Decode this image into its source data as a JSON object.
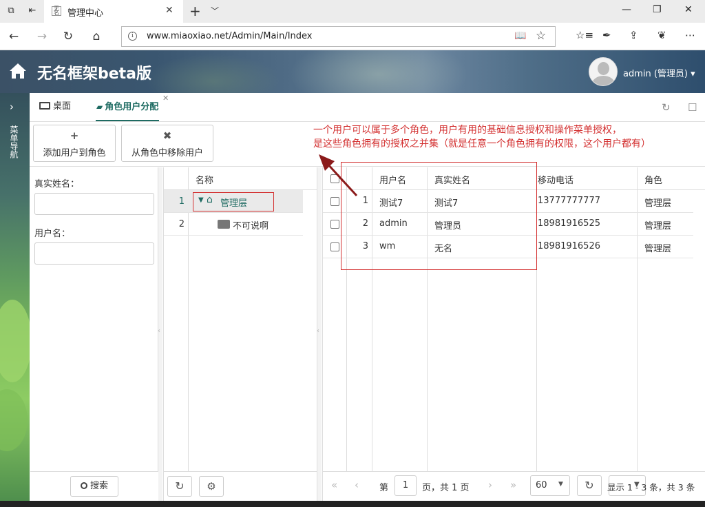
{
  "browser": {
    "tab_title": "管理中心",
    "url": "www.miaoxiao.net/Admin/Main/Index"
  },
  "header": {
    "title": "无名框架beta版",
    "user": "admin (管理员) ▾"
  },
  "sidebar": {
    "vertical_label": "菜单导航"
  },
  "tabs": [
    {
      "label": "桌面"
    },
    {
      "label": "角色用户分配"
    }
  ],
  "toolbar": {
    "add_label": "添加用户到角色",
    "remove_label": "从角色中移除用户"
  },
  "annotation": {
    "line1": "一个用户可以属于多个角色，用户有用的基础信息授权和操作菜单授权，",
    "line2": "是这些角色拥有的授权之并集（就是任意一个角色拥有的权限，这个用户都有）"
  },
  "filters": {
    "real_name_label": "真实姓名：",
    "username_label": "用户名：",
    "search_label": "搜索"
  },
  "tree": {
    "header": "名称",
    "rows": [
      {
        "num": "1",
        "label": "管理层"
      },
      {
        "num": "2",
        "label": "不可说啊"
      }
    ]
  },
  "grid": {
    "columns": [
      "用户名",
      "真实姓名",
      "移动电话",
      "角色"
    ],
    "rows": [
      {
        "num": "1",
        "username": "测试7",
        "realname": "测试7",
        "phone": "13777777777",
        "role": "管理层"
      },
      {
        "num": "2",
        "username": "admin",
        "realname": "管理员",
        "phone": "18981916525",
        "role": "管理层"
      },
      {
        "num": "3",
        "username": "wm",
        "realname": "无名",
        "phone": "18981916526",
        "role": "管理层"
      }
    ]
  },
  "pager": {
    "page_prefix": "第",
    "page_value": "1",
    "page_suffix": "页，共 1 页",
    "page_size": "60",
    "summary": "显示 1 - 3 条，共 3 条"
  },
  "colors": {
    "accent": "#1e6b62",
    "annotation": "#d32f2f"
  }
}
